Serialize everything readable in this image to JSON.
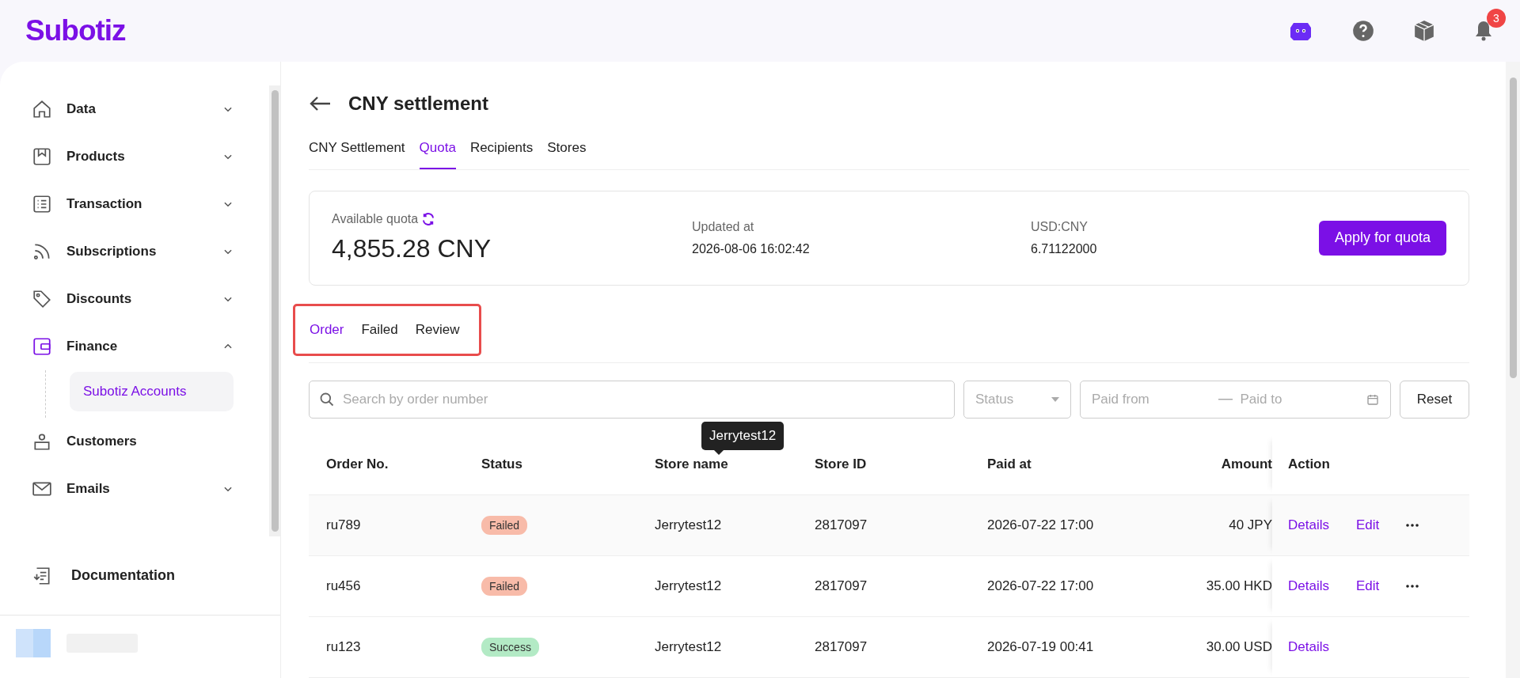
{
  "header": {
    "logo": "Subotiz",
    "notifications": "3"
  },
  "sidebar": {
    "items": [
      {
        "label": "Data",
        "expandable": true,
        "expanded": false,
        "selected": false
      },
      {
        "label": "Products",
        "expandable": true,
        "expanded": false,
        "selected": false
      },
      {
        "label": "Transaction",
        "expandable": true,
        "expanded": false,
        "selected": false
      },
      {
        "label": "Subscriptions",
        "expandable": true,
        "expanded": false,
        "selected": false
      },
      {
        "label": "Discounts",
        "expandable": true,
        "expanded": false,
        "selected": false
      },
      {
        "label": "Finance",
        "expandable": true,
        "expanded": true,
        "selected": true,
        "children": [
          {
            "label": "Subotiz Accounts",
            "selected": true
          }
        ]
      },
      {
        "label": "Customers",
        "expandable": false,
        "selected": false
      },
      {
        "label": "Emails",
        "expandable": true,
        "expanded": false,
        "selected": false
      }
    ],
    "footer": "Documentation"
  },
  "page": {
    "title": "CNY settlement",
    "tabs": [
      {
        "label": "CNY Settlement",
        "selected": false
      },
      {
        "label": "Quota",
        "selected": true
      },
      {
        "label": "Recipients",
        "selected": false
      },
      {
        "label": "Stores",
        "selected": false
      }
    ],
    "quota": {
      "label": "Available quota",
      "value": "4,855.28 CNY",
      "updated_label": "Updated at",
      "updated_value": "2026-08-06 16:02:42",
      "rate_label": "USD:CNY",
      "rate_value": "6.71122000",
      "button": "Apply for quota"
    },
    "subtabs": {
      "outlined": true,
      "items": [
        {
          "label": "Order",
          "selected": true
        },
        {
          "label": "Failed",
          "selected": false
        },
        {
          "label": "Review",
          "selected": false
        }
      ]
    },
    "filters": {
      "search_placeholder": "Search by order number",
      "status_placeholder": "Status",
      "from_placeholder": "Paid from",
      "to_placeholder": "Paid to",
      "reset": "Reset"
    },
    "table": {
      "columns": [
        "Order No.",
        "Status",
        "Store name",
        "Store ID",
        "Paid at",
        "Amount",
        "Action"
      ],
      "rows": [
        {
          "order": "ru789",
          "status": {
            "label": "Failed",
            "kind": "failed"
          },
          "store": "Jerrytest12",
          "store_id": "2817097",
          "paid_at": "2026-07-22 17:00",
          "amount": "40 JPY",
          "highlighted": true,
          "actions": [
            "Details",
            "Edit"
          ],
          "more": true
        },
        {
          "order": "ru456",
          "status": {
            "label": "Failed",
            "kind": "failed"
          },
          "store": "Jerrytest12",
          "store_id": "2817097",
          "paid_at": "2026-07-22 17:00",
          "amount": "35.00 HKD",
          "highlighted": false,
          "actions": [
            "Details",
            "Edit"
          ],
          "more": true
        },
        {
          "order": "ru123",
          "status": {
            "label": "Success",
            "kind": "success"
          },
          "store": "Jerrytest12",
          "store_id": "2817097",
          "paid_at": "2026-07-19 00:41",
          "amount": "30.00 USD",
          "highlighted": false,
          "actions": [
            "Details"
          ],
          "more": false
        }
      ],
      "tooltip": "Jerrytest12"
    }
  }
}
